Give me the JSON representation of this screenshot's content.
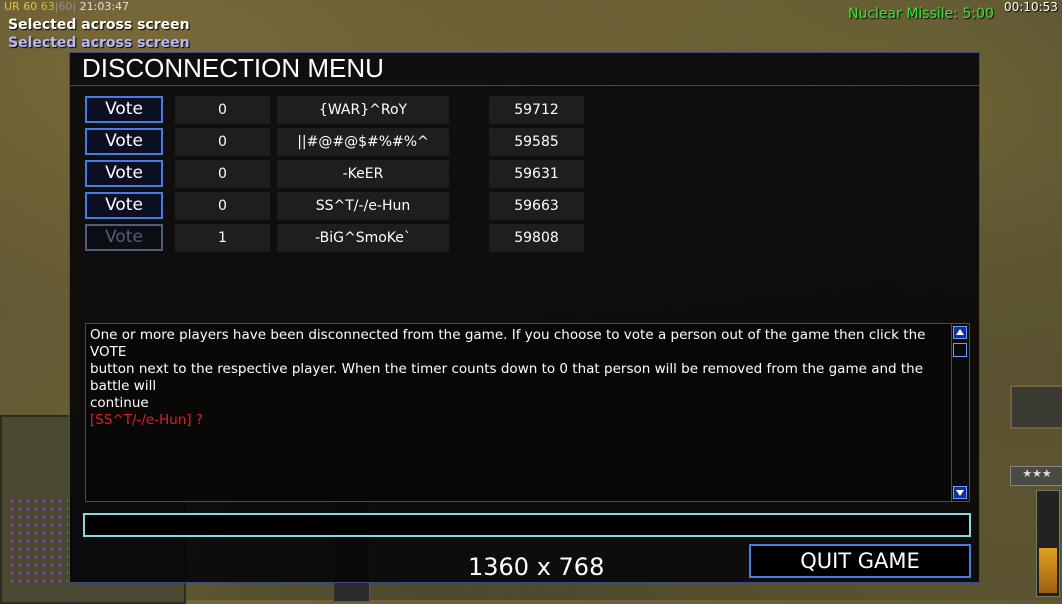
{
  "hud": {
    "ur": "UR",
    "fps1": "60",
    "fps2": "63",
    "fps3": "60",
    "clock": "21:03:47",
    "selected_msg_1": "Selected across screen",
    "selected_msg_2": "Selected across screen",
    "superweapon_timer": "Nuclear Missile: 5:00",
    "game_time": "00:10:53",
    "rank_stars": "★★★"
  },
  "dialog": {
    "title": "DISCONNECTION MENU",
    "vote_label": "Vote",
    "players": [
      {
        "votes": "0",
        "name": "{WAR}^RoY",
        "ping": "59712",
        "vote_enabled": true
      },
      {
        "votes": "0",
        "name": "||#@#@$#%#%^",
        "ping": "59585",
        "vote_enabled": true
      },
      {
        "votes": "0",
        "name": "-KeER",
        "ping": "59631",
        "vote_enabled": true
      },
      {
        "votes": "0",
        "name": "SS^T/-/e-Hun",
        "ping": "59663",
        "vote_enabled": true
      },
      {
        "votes": "1",
        "name": "-BiG^SmoKe`",
        "ping": "59808",
        "vote_enabled": false
      }
    ],
    "message_line1": "One or more players have been disconnected from the game. If you choose to vote a person out of the game then click the VOTE",
    "message_line2": " button next to the respective player. When the timer counts down to 0 that person will be removed from the game and the battle will",
    "message_line3": "continue",
    "message_quote": "[SS^T/-/e-Hun] ?",
    "chat_value": "",
    "resolution": "1360 x 768",
    "quit_label": "QUIT GAME"
  }
}
